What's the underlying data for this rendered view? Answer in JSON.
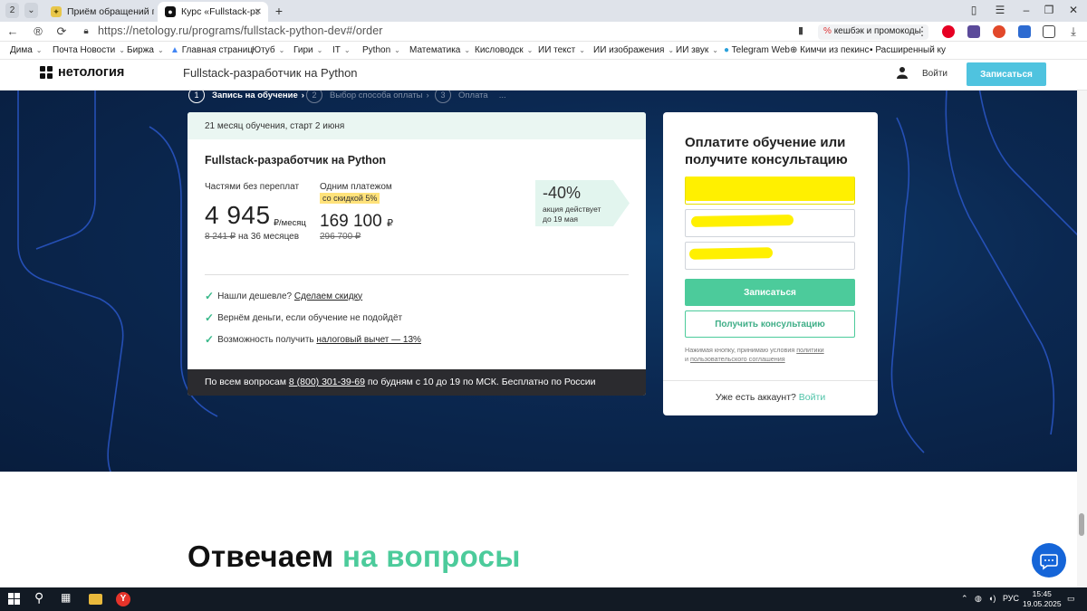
{
  "browser": {
    "tab_counter": "2",
    "tabs": [
      {
        "title": "Приём обращений гражд",
        "active": false
      },
      {
        "title": "Курс «Fullstack-разраб",
        "active": true
      }
    ],
    "url": "https://netology.ru/programs/fullstack-python-dev#/order",
    "cashback_label": "кешбэк и промокоды",
    "bookmarks": [
      {
        "label": "Дима",
        "dropdown": true
      },
      {
        "label": "Почта Новости",
        "dropdown": true
      },
      {
        "label": "Биржа",
        "dropdown": true
      },
      {
        "label": "Главная страниц",
        "dropdown": false
      },
      {
        "label": "Ютуб",
        "dropdown": true
      },
      {
        "label": "Гири",
        "dropdown": true
      },
      {
        "label": "IT",
        "dropdown": true
      },
      {
        "label": "Python",
        "dropdown": true
      },
      {
        "label": "Математика",
        "dropdown": true
      },
      {
        "label": "Кисловодск",
        "dropdown": true
      },
      {
        "label": "ИИ текст",
        "dropdown": true
      },
      {
        "label": "ИИ изображения",
        "dropdown": true
      },
      {
        "label": "ИИ звук",
        "dropdown": true
      },
      {
        "label": "Telegram Web",
        "dropdown": false
      },
      {
        "label": "Кимчи из пекинс",
        "dropdown": false
      },
      {
        "label": "Расширенный ку",
        "dropdown": false
      }
    ]
  },
  "site": {
    "logo_text": "нетология",
    "course_title": "Fullstack-разработчик на Python",
    "login_label": "Войти",
    "enroll_label": "Записаться"
  },
  "steps": [
    {
      "num": "1",
      "label": "Запись на обучение",
      "active": true
    },
    {
      "num": "2",
      "label": "Выбор способа оплаты",
      "active": false
    },
    {
      "num": "3",
      "label": "Оплата",
      "active": false
    }
  ],
  "steps_ellipsis": "...",
  "order": {
    "duration": "21 месяц обучения, старт 2 июня",
    "title": "Fullstack-разработчик на Python",
    "installment_label": "Частями без переплат",
    "installment_price": "4 945",
    "installment_unit": "₽/месяц",
    "installment_old": "8 241 ₽",
    "installment_term": "на 36 месяцев",
    "single_label": "Одним платежом",
    "single_discount": "со скидкой 5%",
    "single_price": "169 100",
    "single_currency": "₽",
    "single_old": "296 700 ₽",
    "promo_pct": "-40%",
    "promo_line1": "акция действует",
    "promo_line2": "до 19 мая",
    "checks": [
      {
        "text": "Нашли дешевле? ",
        "link": "Сделаем скидку",
        "tail": ""
      },
      {
        "text": "Вернём деньги, если обучение не подойдёт",
        "link": "",
        "tail": ""
      },
      {
        "text": "Возможность получить ",
        "link": "налоговый вычет — 13%",
        "tail": ""
      }
    ],
    "footer_pre": "По всем вопросам ",
    "footer_phone": "8 (800) 301-39-69",
    "footer_post": " по будням с 10 до 19 по МСК. Бесплатно по России"
  },
  "form": {
    "title": "Оплатите обучение или получите консультацию",
    "submit_label": "Записаться",
    "consult_label": "Получить консультацию",
    "agree_pre": "Нажимая кнопку, принимаю условия ",
    "agree_link1": "политики",
    "agree_mid": "и ",
    "agree_link2": "пользовательского соглашения",
    "account_text": "Уже есть аккаунт? ",
    "account_link": "Войти"
  },
  "faq": {
    "heading_a": "Отвечаем ",
    "heading_b": "на вопросы"
  },
  "taskbar": {
    "lang": "РУС",
    "time": "15:45",
    "date": "19.05.2025"
  },
  "colors": {
    "accent_green": "#4ccb9b",
    "accent_blue": "#4fc3df",
    "hero_bg": "#0b2851",
    "redaction": "#fff000"
  }
}
